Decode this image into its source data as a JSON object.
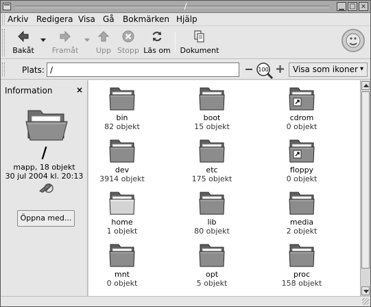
{
  "window": {
    "title": "/"
  },
  "menubar": {
    "items": [
      "Arkiv",
      "Redigera",
      "Visa",
      "Gå",
      "Bokmärken",
      "Hjälp"
    ]
  },
  "toolbar": {
    "back": "Bakåt",
    "forward": "Framåt",
    "up": "Upp",
    "stop": "Stopp",
    "reload": "Läs om",
    "documents": "Dokument"
  },
  "location": {
    "label": "Plats:",
    "value": "/",
    "zoom": "100",
    "view_mode": "Visa som ikoner"
  },
  "sidepane": {
    "title": "Information",
    "close_glyph": "×",
    "name": "/",
    "info_line1": "mapp, 18 objekt",
    "info_line2": "30 jul 2004 kl. 20:13",
    "open_button": "Öppna med..."
  },
  "files": [
    {
      "name": "bin",
      "count": "82 objekt",
      "type": "folder"
    },
    {
      "name": "boot",
      "count": "15 objekt",
      "type": "folder"
    },
    {
      "name": "cdrom",
      "count": "0 objekt",
      "type": "link"
    },
    {
      "name": "dev",
      "count": "3914 objekt",
      "type": "folder"
    },
    {
      "name": "etc",
      "count": "175 objekt",
      "type": "folder"
    },
    {
      "name": "floppy",
      "count": "0 objekt",
      "type": "link"
    },
    {
      "name": "home",
      "count": "1 objekt",
      "type": "home"
    },
    {
      "name": "lib",
      "count": "80 objekt",
      "type": "folder"
    },
    {
      "name": "media",
      "count": "2 objekt",
      "type": "folder"
    },
    {
      "name": "mnt",
      "count": "0 objekt",
      "type": "folder"
    },
    {
      "name": "opt",
      "count": "5 objekt",
      "type": "folder"
    },
    {
      "name": "proc",
      "count": "158 objekt",
      "type": "folder"
    }
  ],
  "colors": {
    "titlebar": "#a9a9a9",
    "folder_tab": "#6e6e6e",
    "folder_body": "#8c8c8c"
  }
}
